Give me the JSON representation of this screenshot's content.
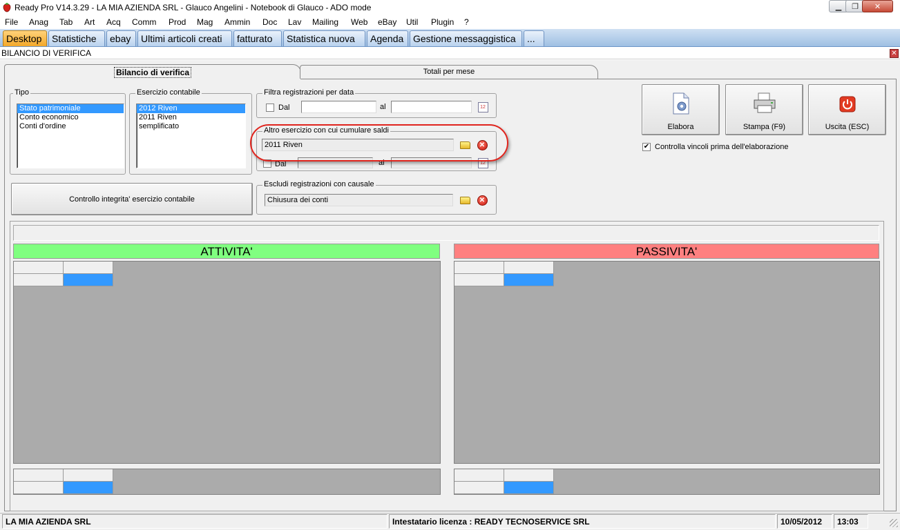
{
  "window": {
    "title": "Ready Pro V14.3.29 - LA MIA AZIENDA SRL - Glauco Angelini - Notebook di Glauco - ADO mode"
  },
  "menu": [
    {
      "label": "File"
    },
    {
      "label": "Anag"
    },
    {
      "label": "Tab"
    },
    {
      "label": "Art"
    },
    {
      "label": "Acq"
    },
    {
      "label": "Comm"
    },
    {
      "label": "Prod"
    },
    {
      "label": "Mag"
    },
    {
      "label": "Ammin"
    },
    {
      "label": "Doc"
    },
    {
      "label": "Lav"
    },
    {
      "label": "Mailing"
    },
    {
      "label": "Web"
    },
    {
      "label": "eBay"
    },
    {
      "label": "Util"
    },
    {
      "label": "Plugin"
    },
    {
      "label": "?"
    }
  ],
  "app_tabs": [
    {
      "label": "Desktop"
    },
    {
      "label": "Statistiche"
    },
    {
      "label": "ebay"
    },
    {
      "label": "Ultimi articoli creati"
    },
    {
      "label": "fatturato"
    },
    {
      "label": "Statistica nuova"
    },
    {
      "label": "Agenda"
    },
    {
      "label": "Gestione messaggistica"
    },
    {
      "label": "..."
    }
  ],
  "form": {
    "title": "BILANCIO DI VERIFICA",
    "tabs": [
      {
        "label": "Bilancio di verifica"
      },
      {
        "label": "Totali per mese"
      }
    ]
  },
  "tipo": {
    "label": "Tipo",
    "items": [
      "Stato patrimoniale",
      "Conto economico",
      "Conti d'ordine"
    ],
    "selected": "Stato patrimoniale"
  },
  "esercizio": {
    "label": "Esercizio contabile",
    "items": [
      "2012 Riven",
      "2011 Riven",
      "semplificato"
    ],
    "selected": "2012 Riven"
  },
  "filtra": {
    "label": "Filtra registrazioni per data",
    "dal_label": "Dal",
    "al_label": "al",
    "dal_value": "",
    "al_value": ""
  },
  "altro_esercizio": {
    "label": "Altro esercizio con cui cumulare saldi",
    "value": "2011 Riven",
    "dal_label": "Dal",
    "al_label": "al"
  },
  "controllo_button": "Controllo integrita' esercizio contabile",
  "escludi": {
    "label": "Escludi registrazioni con causale",
    "value": "Chiusura dei conti"
  },
  "actions": {
    "elabora": "Elabora",
    "stampa": "Stampa (F9)",
    "uscita": "Uscita (ESC)",
    "controlla_label": "Controlla vincoli prima dell'elaborazione",
    "controlla_checked": "✔"
  },
  "results": {
    "attivita": "ATTIVITA'",
    "passivita": "PASSIVITA'",
    "colors": {
      "attivita": "#80ff80",
      "passivita": "#ff8080",
      "selected_cell": "#3399ff"
    }
  },
  "status": {
    "company": "LA MIA AZIENDA SRL",
    "license": "Intestatario licenza : READY TECNOSERVICE SRL",
    "date": "10/05/2012",
    "time": "13:03"
  }
}
